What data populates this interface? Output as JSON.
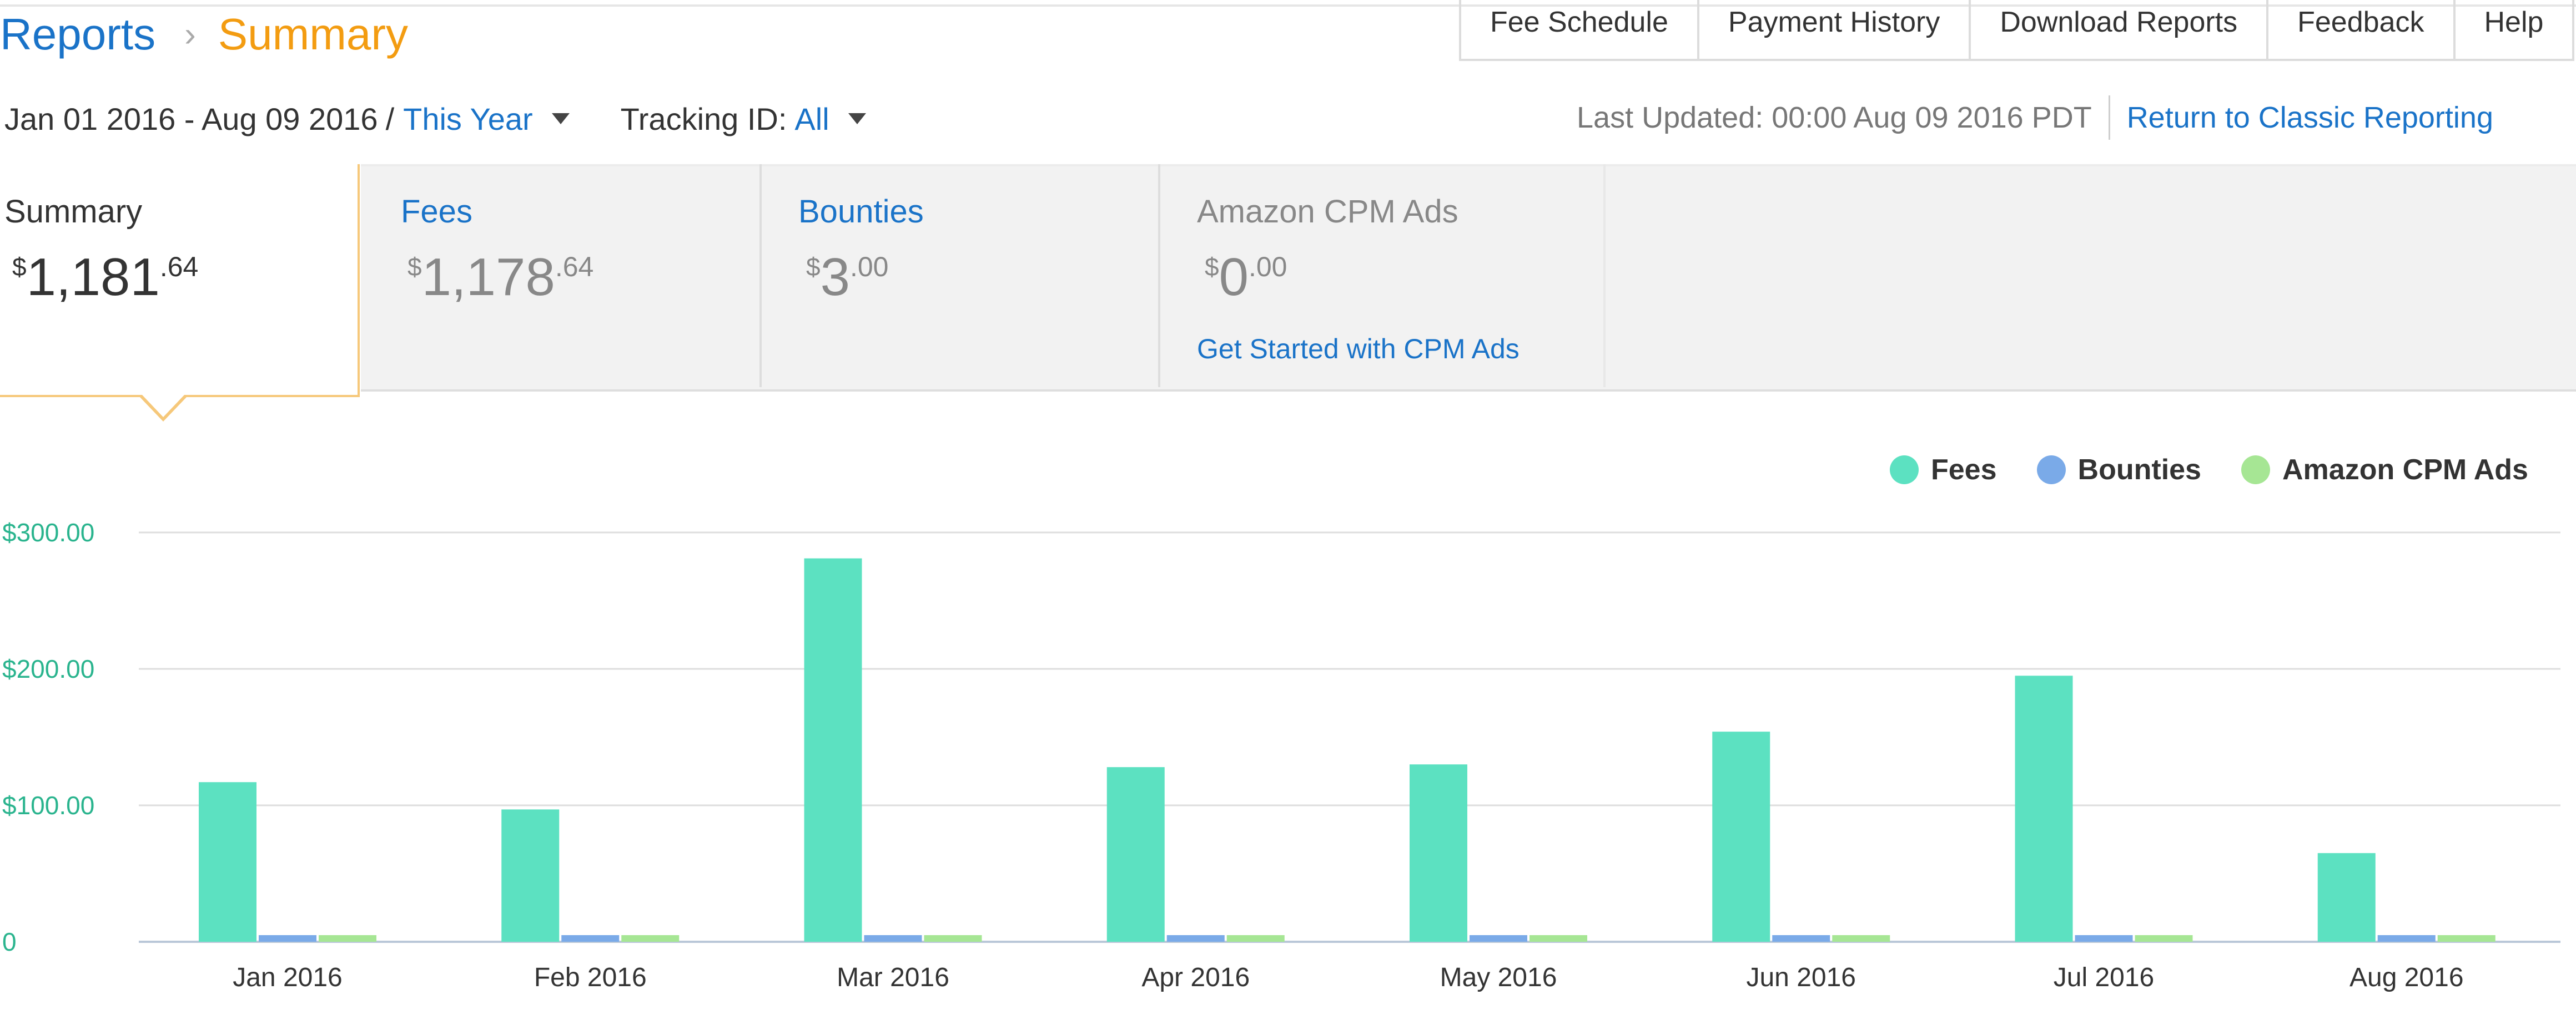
{
  "breadcrumb": {
    "parent": "Reports",
    "separator": "›",
    "current": "Summary"
  },
  "topnav": [
    "Fee Schedule",
    "Payment History",
    "Download Reports",
    "Feedback",
    "Help"
  ],
  "filters": {
    "date_range": "Jan 01 2016 - Aug 09 2016",
    "slash": "/",
    "period": "This Year",
    "tracking_label": "Tracking ID:",
    "tracking_value": "All"
  },
  "last_updated": "Last Updated: 00:00 Aug 09 2016 PDT",
  "classic_link": "Return to Classic Reporting",
  "tiles": {
    "summary": {
      "title": "Summary",
      "currency": "$",
      "whole": "1,181",
      "cents": ".64"
    },
    "fees": {
      "title": "Fees",
      "currency": "$",
      "whole": "1,178",
      "cents": ".64"
    },
    "bounties": {
      "title": "Bounties",
      "currency": "$",
      "whole": "3",
      "cents": ".00"
    },
    "cpm": {
      "title": "Amazon CPM Ads",
      "currency": "$",
      "whole": "0",
      "cents": ".00",
      "link": "Get Started with CPM Ads"
    }
  },
  "colors": {
    "fees": "#5ce1c1",
    "bounties": "#7aaae8",
    "cpm": "#a6e694",
    "axis_label": "#2ab48e",
    "link": "#1a73c8",
    "accent": "#f39c11"
  },
  "chart_data": {
    "type": "bar",
    "categories": [
      "Jan 2016",
      "Feb 2016",
      "Mar 2016",
      "Apr 2016",
      "May 2016",
      "Jun 2016",
      "Jul 2016",
      "Aug 2016"
    ],
    "series": [
      {
        "name": "Fees",
        "values": [
          117,
          97,
          281,
          128,
          130,
          154,
          195,
          65
        ]
      },
      {
        "name": "Bounties",
        "values": [
          1,
          0.5,
          0.5,
          0.5,
          0,
          0.5,
          0,
          0
        ]
      },
      {
        "name": "Amazon CPM Ads",
        "values": [
          0,
          0,
          0,
          0,
          0,
          0,
          0,
          0
        ]
      }
    ],
    "yticks": [
      0,
      100,
      200,
      300
    ],
    "ytick_labels": [
      "0",
      "$100.00",
      "$200.00",
      "$300.00"
    ],
    "ylim": [
      0,
      300
    ],
    "grid": true,
    "legend_position": "top-right"
  }
}
